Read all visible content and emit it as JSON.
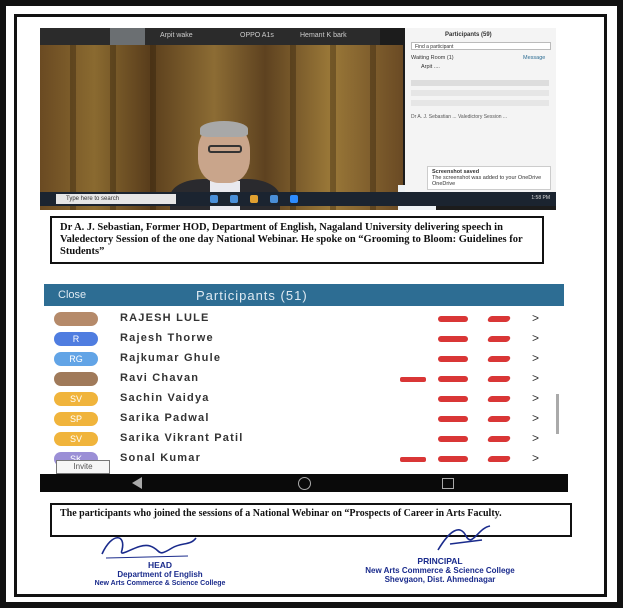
{
  "screenshot1": {
    "topbar_names": [
      "Arpit wake",
      "OPPO A1s",
      "Hemant K bark"
    ],
    "panel_title": "Participants (59)",
    "panel_search": "Find a participant",
    "waiting_room": "Waiting Room (1)",
    "waiting_action": "Message",
    "panel_user": "Arpit ....",
    "panel_message": "Dr A. J. Sebastian ... Valedictory Session ...",
    "toast_title": "Screenshot saved",
    "toast_body": "The screenshot was added to your OneDrive",
    "toast_source": "OneDrive",
    "taskbar_search": "Type here to search",
    "taskbar_time": "1:58 PM"
  },
  "caption1": "Dr A. J. Sebastian, Former HOD, Department of English, Nagaland University delivering speech in Valedectory Session of the one day National Webinar. He spoke on “Grooming to Bloom: Guidelines for Students”",
  "screenshot2": {
    "close_label": "Close",
    "title": "Participants (51)",
    "participants": [
      {
        "initials": "",
        "name": "RAJESH LULE",
        "color": "#b58a6a"
      },
      {
        "initials": "R",
        "name": "Rajesh Thorwe",
        "color": "#4f7de0"
      },
      {
        "initials": "RG",
        "name": "Rajkumar Ghule",
        "color": "#62a4e6"
      },
      {
        "initials": "",
        "name": "Ravi Chavan",
        "color": "#a07a5a"
      },
      {
        "initials": "SV",
        "name": "Sachin Vaidya",
        "color": "#f0b43c"
      },
      {
        "initials": "SP",
        "name": "Sarika Padwal",
        "color": "#f0b43c"
      },
      {
        "initials": "SV",
        "name": "Sarika Vikrant Patil",
        "color": "#f0b43c"
      },
      {
        "initials": "SK",
        "name": "Sonal Kumar",
        "color": "#9b8fd6"
      }
    ],
    "invite_label": "Invite"
  },
  "caption2": "The participants who joined the sessions of a National Webinar on “Prospects of Career in Arts Faculty.",
  "signatures": {
    "head": {
      "title": "HEAD",
      "line1": "Department of English",
      "line2": "New Arts Commerce & Science College"
    },
    "principal": {
      "title": "PRINCIPAL",
      "line1": "New Arts Commerce & Science College",
      "line2": "Shevgaon, Dist. Ahmednagar"
    }
  },
  "colors": {
    "zoom_blue": "#2d6d93",
    "mute_red": "#d93636",
    "sign_ink": "#1a2b8c"
  }
}
